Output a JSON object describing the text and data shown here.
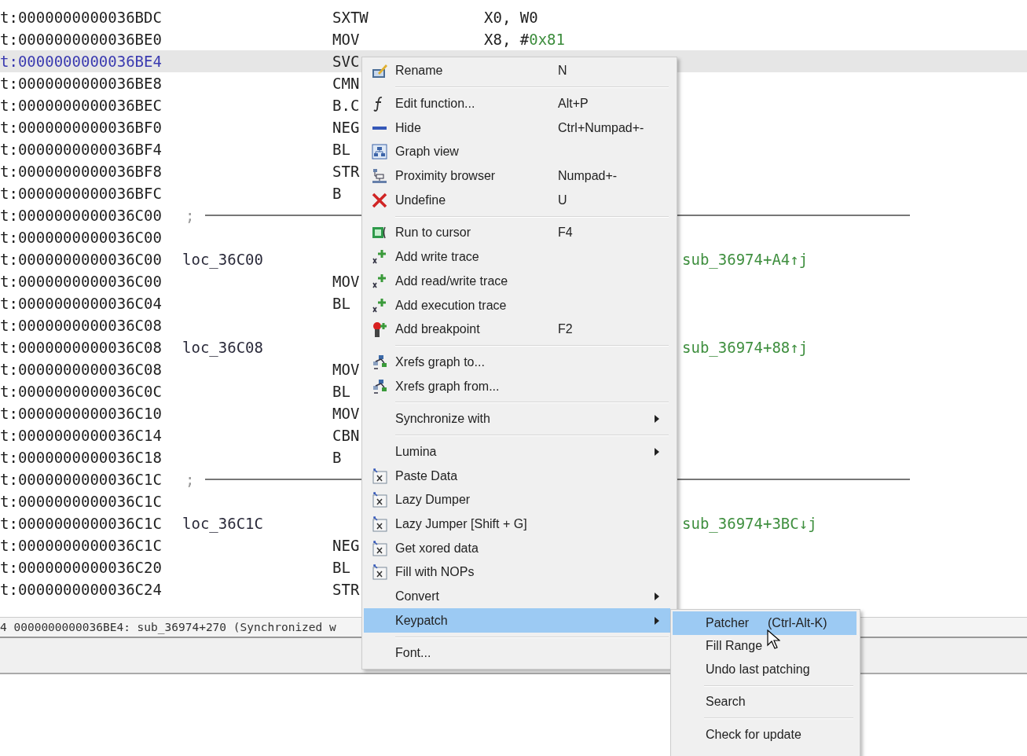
{
  "listing": {
    "rows": [
      {
        "kind": "code",
        "address": "t:0000000000036BDC",
        "mnemonic": "SXTW",
        "operands": [
          {
            "kind": "reg",
            "text": "X0, W0"
          }
        ],
        "selected": false
      },
      {
        "kind": "code",
        "address": "t:0000000000036BE0",
        "mnemonic": "MOV",
        "operands": [
          {
            "kind": "reg",
            "text": "X8, #"
          },
          {
            "kind": "number",
            "text": "0x81"
          }
        ],
        "selected": false
      },
      {
        "kind": "code",
        "address": "t:0000000000036BE4",
        "mnemonic": "SVC",
        "selected": true
      },
      {
        "kind": "code",
        "address": "t:0000000000036BE8",
        "mnemonic": "CMN",
        "selected": false
      },
      {
        "kind": "code",
        "address": "t:0000000000036BEC",
        "mnemonic": "B.C",
        "selected": false
      },
      {
        "kind": "code",
        "address": "t:0000000000036BF0",
        "mnemonic": "NEG",
        "selected": false
      },
      {
        "kind": "code",
        "address": "t:0000000000036BF4",
        "mnemonic": "BL",
        "selected": false
      },
      {
        "kind": "code",
        "address": "t:0000000000036BF8",
        "mnemonic": "STR",
        "selected": false
      },
      {
        "kind": "code",
        "address": "t:0000000000036BFC",
        "mnemonic": "B",
        "selected": false
      },
      {
        "kind": "separator",
        "address": "t:0000000000036C00",
        "mark": ";",
        "selected": false
      },
      {
        "kind": "code",
        "address": "t:0000000000036C00",
        "selected": false
      },
      {
        "kind": "code",
        "address": "t:0000000000036C00",
        "label": "loc_36C00",
        "comment": "sub_36974+A4↑j",
        "selected": false
      },
      {
        "kind": "code",
        "address": "t:0000000000036C00",
        "mnemonic": "MOV",
        "selected": false
      },
      {
        "kind": "code",
        "address": "t:0000000000036C04",
        "mnemonic": "BL",
        "selected": false
      },
      {
        "kind": "code",
        "address": "t:0000000000036C08",
        "selected": false
      },
      {
        "kind": "code",
        "address": "t:0000000000036C08",
        "label": "loc_36C08",
        "comment": "sub_36974+88↑j",
        "selected": false
      },
      {
        "kind": "code",
        "address": "t:0000000000036C08",
        "mnemonic": "MOV",
        "selected": false
      },
      {
        "kind": "code",
        "address": "t:0000000000036C0C",
        "mnemonic": "BL",
        "selected": false
      },
      {
        "kind": "code",
        "address": "t:0000000000036C10",
        "mnemonic": "MOV",
        "selected": false
      },
      {
        "kind": "code",
        "address": "t:0000000000036C14",
        "mnemonic": "CBN",
        "selected": false
      },
      {
        "kind": "code",
        "address": "t:0000000000036C18",
        "mnemonic": "B",
        "selected": false
      },
      {
        "kind": "separator",
        "address": "t:0000000000036C1C",
        "mark": ";",
        "selected": false
      },
      {
        "kind": "code",
        "address": "t:0000000000036C1C",
        "selected": false
      },
      {
        "kind": "code",
        "address": "t:0000000000036C1C",
        "label": "loc_36C1C",
        "comment": "sub_36974+3BC↓j",
        "selected": false
      },
      {
        "kind": "code",
        "address": "t:0000000000036C1C",
        "mnemonic": "NEG",
        "selected": false
      },
      {
        "kind": "code",
        "address": "t:0000000000036C20",
        "mnemonic": "BL",
        "selected": false
      },
      {
        "kind": "code",
        "address": "t:0000000000036C24",
        "mnemonic": "STR",
        "selected": false
      }
    ]
  },
  "status_bar": {
    "text": "4 0000000000036BE4: sub_36974+270 (Synchronized w"
  },
  "context_menu": {
    "items": [
      {
        "kind": "rename",
        "label": "Rename",
        "shortcut": "N",
        "selected": false
      },
      {
        "kind": "separator"
      },
      {
        "kind": "function",
        "label": "Edit function...",
        "shortcut": "Alt+P",
        "selected": false
      },
      {
        "kind": "hide",
        "label": "Hide",
        "shortcut": "Ctrl+Numpad+-",
        "selected": false
      },
      {
        "kind": "graph",
        "label": "Graph view",
        "selected": false
      },
      {
        "kind": "proximity",
        "label": "Proximity browser",
        "shortcut": "Numpad+-",
        "selected": false
      },
      {
        "kind": "undefine",
        "label": "Undefine",
        "shortcut": "U",
        "selected": false
      },
      {
        "kind": "separator"
      },
      {
        "kind": "run",
        "label": "Run to cursor",
        "shortcut": "F4",
        "selected": false
      },
      {
        "kind": "trace",
        "label": "Add write trace",
        "selected": false
      },
      {
        "kind": "trace",
        "label": "Add read/write trace",
        "selected": false
      },
      {
        "kind": "trace",
        "label": "Add execution trace",
        "selected": false
      },
      {
        "kind": "breakpoint",
        "label": "Add breakpoint",
        "shortcut": "F2",
        "selected": false
      },
      {
        "kind": "separator"
      },
      {
        "kind": "xrefs",
        "label": "Xrefs graph to...",
        "selected": false
      },
      {
        "kind": "xrefs",
        "label": "Xrefs graph from...",
        "selected": false
      },
      {
        "kind": "separator"
      },
      {
        "kind": "submenu",
        "label": "Synchronize with",
        "selected": false
      },
      {
        "kind": "separator"
      },
      {
        "kind": "submenu",
        "label": "Lumina",
        "selected": false
      },
      {
        "kind": "plugin",
        "label": "Paste Data",
        "selected": false
      },
      {
        "kind": "plugin",
        "label": "Lazy Dumper",
        "selected": false
      },
      {
        "kind": "plugin",
        "label": "Lazy Jumper [Shift + G]",
        "selected": false
      },
      {
        "kind": "plugin",
        "label": "Get xored data",
        "selected": false
      },
      {
        "kind": "plugin",
        "label": "Fill with NOPs",
        "selected": false
      },
      {
        "kind": "submenu",
        "label": "Convert",
        "selected": false
      },
      {
        "kind": "submenu",
        "label": "Keypatch",
        "selected": true
      },
      {
        "kind": "separator"
      },
      {
        "kind": "plain",
        "label": "Font...",
        "selected": false
      }
    ]
  },
  "submenu": {
    "items": [
      {
        "kind": "item",
        "label": "Patcher",
        "shortcut": "(Ctrl-Alt-K)",
        "selected": true
      },
      {
        "kind": "item",
        "label": "Fill Range",
        "selected": false
      },
      {
        "kind": "item",
        "label": "Undo last patching",
        "selected": false
      },
      {
        "kind": "separator"
      },
      {
        "kind": "item",
        "label": "Search",
        "selected": false
      },
      {
        "kind": "separator"
      },
      {
        "kind": "item",
        "label": "Check for update",
        "selected": false
      }
    ]
  }
}
